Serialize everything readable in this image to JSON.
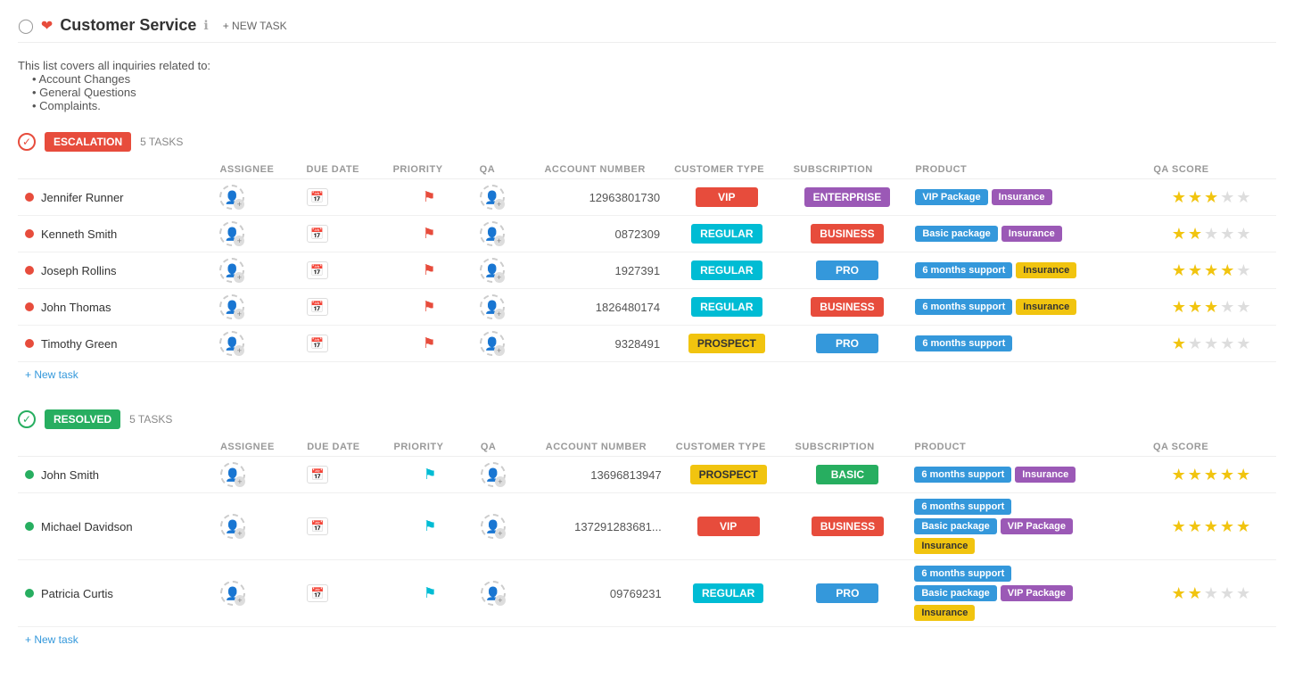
{
  "header": {
    "title": "Customer Service",
    "new_task_label": "+ NEW TASK",
    "info_icon": "ℹ"
  },
  "description": {
    "intro": "This list covers all inquiries related to:",
    "items": [
      "Account Changes",
      "General Questions",
      "Complaints."
    ]
  },
  "columns": {
    "assignee": "ASSIGNEE",
    "due_date": "DUE DATE",
    "priority": "PRIORITY",
    "qa": "QA",
    "account_number": "ACCOUNT NUMBER",
    "customer_type": "CUSTOMER TYPE",
    "subscription": "SUBSCRIPTION",
    "product": "PRODUCT",
    "qa_score": "QA SCORE"
  },
  "sections": [
    {
      "id": "escalation",
      "badge": "ESCALATION",
      "type": "escalation",
      "count": "5 TASKS",
      "tasks": [
        {
          "name": "Jennifer Runner",
          "account": "12963801730",
          "customer_type": "VIP",
          "customer_type_class": "ctype-vip",
          "subscription": "ENTERPRISE",
          "subscription_class": "sub-enterprise",
          "products": [
            {
              "label": "VIP Package",
              "class": "tag-blue"
            },
            {
              "label": "Insurance",
              "class": "tag-purple"
            }
          ],
          "stars": [
            1,
            1,
            1,
            0,
            0
          ]
        },
        {
          "name": "Kenneth Smith",
          "account": "0872309",
          "customer_type": "REGULAR",
          "customer_type_class": "ctype-regular",
          "subscription": "BUSINESS",
          "subscription_class": "sub-business",
          "products": [
            {
              "label": "Basic package",
              "class": "tag-blue"
            },
            {
              "label": "Insurance",
              "class": "tag-purple"
            }
          ],
          "stars": [
            1,
            1,
            0,
            0,
            0
          ]
        },
        {
          "name": "Joseph Rollins",
          "account": "1927391",
          "customer_type": "REGULAR",
          "customer_type_class": "ctype-regular",
          "subscription": "PRO",
          "subscription_class": "sub-pro",
          "products": [
            {
              "label": "6 months support",
              "class": "tag-blue"
            },
            {
              "label": "Insurance",
              "class": "tag-yellow"
            }
          ],
          "stars": [
            1,
            1,
            1,
            1,
            0
          ]
        },
        {
          "name": "John Thomas",
          "account": "1826480174",
          "customer_type": "REGULAR",
          "customer_type_class": "ctype-regular",
          "subscription": "BUSINESS",
          "subscription_class": "sub-business",
          "products": [
            {
              "label": "6 months support",
              "class": "tag-blue"
            },
            {
              "label": "Insurance",
              "class": "tag-yellow"
            }
          ],
          "stars": [
            1,
            1,
            1,
            0,
            0
          ]
        },
        {
          "name": "Timothy Green",
          "account": "9328491",
          "customer_type": "PROSPECT",
          "customer_type_class": "ctype-prospect",
          "subscription": "PRO",
          "subscription_class": "sub-pro",
          "products": [
            {
              "label": "6 months support",
              "class": "tag-blue"
            }
          ],
          "stars": [
            1,
            0,
            0,
            0,
            0
          ]
        }
      ],
      "new_task_label": "+ New task"
    },
    {
      "id": "resolved",
      "badge": "RESOLVED",
      "type": "resolved",
      "count": "5 TASKS",
      "tasks": [
        {
          "name": "John Smith",
          "account": "13696813947",
          "customer_type": "PROSPECT",
          "customer_type_class": "ctype-prospect",
          "subscription": "BASIC",
          "subscription_class": "sub-basic",
          "products": [
            {
              "label": "6 months support",
              "class": "tag-blue"
            },
            {
              "label": "Insurance",
              "class": "tag-purple"
            }
          ],
          "stars": [
            1,
            1,
            1,
            1,
            1
          ]
        },
        {
          "name": "Michael Davidson",
          "account": "137291283681...",
          "customer_type": "VIP",
          "customer_type_class": "ctype-vip",
          "subscription": "BUSINESS",
          "subscription_class": "sub-business",
          "products": [
            {
              "label": "6 months support",
              "class": "tag-blue"
            },
            {
              "label": "Basic package",
              "class": "tag-blue"
            },
            {
              "label": "VIP Package",
              "class": "tag-purple"
            },
            {
              "label": "Insurance",
              "class": "tag-yellow"
            }
          ],
          "stars": [
            1,
            1,
            1,
            1,
            1
          ]
        },
        {
          "name": "Patricia Curtis",
          "account": "09769231",
          "customer_type": "REGULAR",
          "customer_type_class": "ctype-regular",
          "subscription": "PRO",
          "subscription_class": "sub-pro",
          "products": [
            {
              "label": "6 months support",
              "class": "tag-blue"
            },
            {
              "label": "Basic package",
              "class": "tag-blue"
            },
            {
              "label": "VIP Package",
              "class": "tag-purple"
            },
            {
              "label": "Insurance",
              "class": "tag-yellow"
            }
          ],
          "stars": [
            1,
            1,
            0,
            0,
            0
          ]
        }
      ],
      "new_task_label": "+ New task"
    }
  ]
}
